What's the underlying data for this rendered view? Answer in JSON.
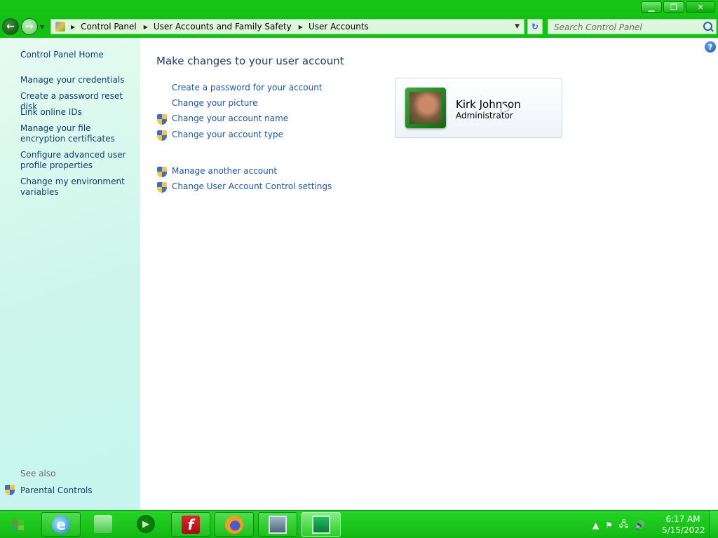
{
  "window": {
    "minimize_glyph": "▁",
    "restore_glyph": "❐",
    "close_glyph": "✕"
  },
  "navigation": {
    "back_glyph": "←",
    "forward_glyph": "→",
    "breadcrumbs": [
      "Control Panel",
      "User Accounts and Family Safety",
      "User Accounts"
    ],
    "search_placeholder": "Search Control Panel"
  },
  "left_pane": {
    "home_link": "Control Panel Home",
    "links": [
      "Manage your credentials",
      "Create a password reset disk",
      "Link online IDs",
      "Manage your file encryption certificates",
      "Configure advanced user profile properties",
      "Change my environment variables"
    ],
    "see_also_label": "See also",
    "see_also_links": [
      "Parental Controls"
    ]
  },
  "main": {
    "title": "Make changes to your user account",
    "tasks": [
      {
        "label": "Create a password for your account",
        "shield": false
      },
      {
        "label": "Change your picture",
        "shield": false
      },
      {
        "label": "Change your account name",
        "shield": true
      },
      {
        "label": "Change your account type",
        "shield": true
      }
    ],
    "other_tasks": [
      {
        "label": "Manage another account",
        "shield": true
      },
      {
        "label": "Change User Account Control settings",
        "shield": true
      }
    ],
    "user": {
      "name": "Kirk Johnson",
      "role": "Administrator"
    },
    "help_glyph": "?"
  },
  "taskbar": {
    "apps": [
      "internet-explorer-icon",
      "windows-explorer-icon",
      "media-player-icon",
      "flash-icon",
      "firefox-icon",
      "system-monitor-icon",
      "control-panel-icon"
    ],
    "media_glyph": "▶",
    "flash_glyph": "f",
    "ie_glyph": "e",
    "tray": {
      "up_glyph": "▲",
      "flag_glyph": "⚑",
      "network_glyph": "🖧",
      "volume_glyph": "🔊"
    },
    "clock": {
      "time": "6:17 AM",
      "date": "5/15/2022"
    }
  }
}
